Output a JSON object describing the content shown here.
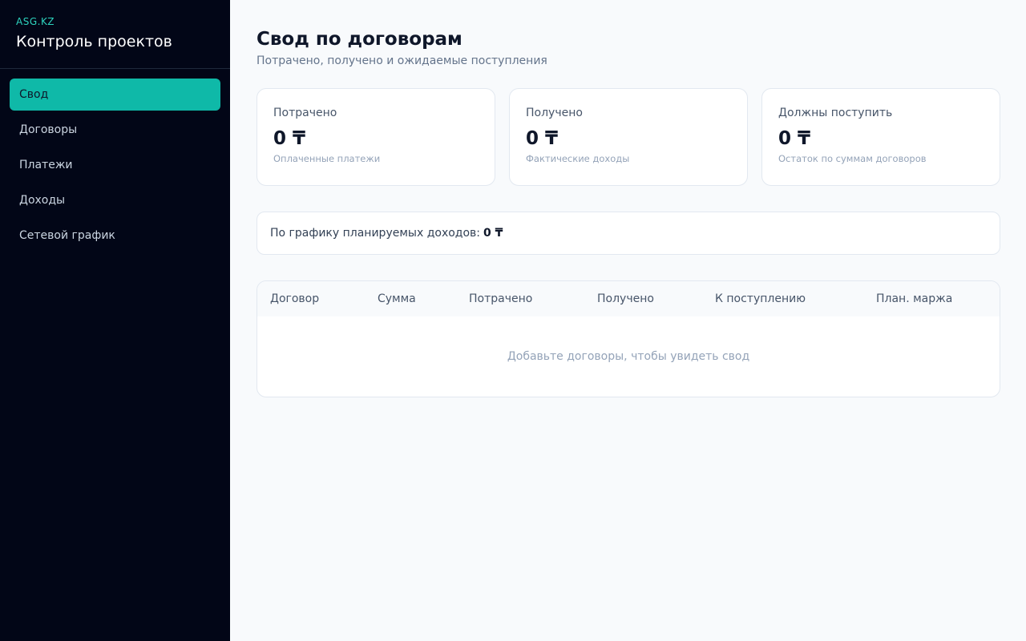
{
  "brand": {
    "sub": "ASG.KZ",
    "title": "Контроль проектов"
  },
  "nav": [
    {
      "label": "Свод",
      "active": true
    },
    {
      "label": "Договоры"
    },
    {
      "label": "Платежи"
    },
    {
      "label": "Доходы"
    },
    {
      "label": "Сетевой график"
    }
  ],
  "page": {
    "title": "Свод по договорам",
    "subtitle": "Потрачено, получено и ожидаемые поступления"
  },
  "cards": [
    {
      "label": "Потрачено",
      "value": "0 ₸",
      "note": "Оплаченные платежи"
    },
    {
      "label": "Получено",
      "value": "0 ₸",
      "note": "Фактические доходы"
    },
    {
      "label": "Должны поступить",
      "value": "0 ₸",
      "note": "Остаток по суммам договоров"
    }
  ],
  "planned": {
    "label": "По графику планируемых доходов:",
    "value": "0 ₸"
  },
  "table": {
    "columns": [
      "Договор",
      "Сумма",
      "Потрачено",
      "Получено",
      "К поступлению",
      "План. маржа"
    ],
    "empty_text": "Добавьте договоры, чтобы увидеть свод"
  },
  "colors": {
    "sidebar_bg": "#020617",
    "accent": "#0fb9a8",
    "brand_sub": "#2dd4bf"
  }
}
